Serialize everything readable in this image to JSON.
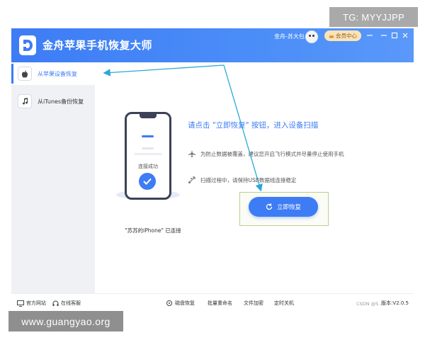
{
  "watermarks": {
    "top_right": "TG: MYYJJPP",
    "bottom_left": "www.guangyao.org",
    "csdn": "CSDN @S..."
  },
  "titlebar": {
    "app_title": "金舟苹果手机恢复大师",
    "user_name": "金舟-苏大包",
    "member_button": "会员中心",
    "controls": [
      "minimize",
      "menu",
      "maximize",
      "close"
    ]
  },
  "sidebar": {
    "items": [
      {
        "label": "从苹果设备恢复",
        "icon": "apple-icon",
        "active": true
      },
      {
        "label": "从iTunes备份恢复",
        "icon": "music-note-icon",
        "active": false
      }
    ]
  },
  "main": {
    "phone_status": "连接成功",
    "device_label": "\"苏苏的iPhone\" 已连接",
    "prompt_title": "请点击 \"立即恢复\" 按钮，进入设备扫描",
    "tips": [
      "为防止数据被覆盖，建议您开启飞行模式并尽量停止使用手机",
      "扫描过程中，请保持USB数据线连接稳定"
    ],
    "recover_button": "立即恢复"
  },
  "footer": {
    "official_site": "官方网站",
    "online_service": "在线客服",
    "links": [
      "磁盘恢复",
      "批量重命名",
      "文件加密",
      "定时关机"
    ],
    "version": "版本:V2.0.5"
  },
  "colors": {
    "accent": "#3d7cf5",
    "annotation_arrow": "#2aa9d6",
    "highlight_frame": "#b9d08f"
  }
}
